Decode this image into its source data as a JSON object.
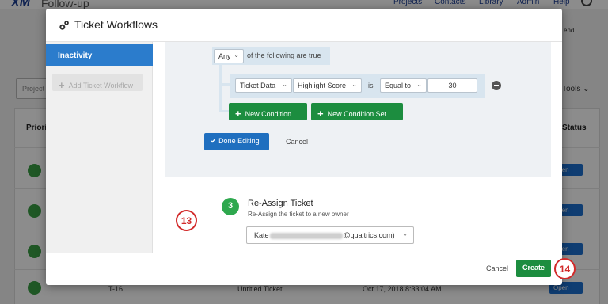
{
  "background": {
    "app_name": "Follow-up",
    "nav": [
      "Projects",
      "Contacts",
      "Library",
      "Admin",
      "Help"
    ],
    "right_snippet": "end",
    "projects_placeholder": "Project",
    "tools_label": "Tools",
    "priority_header": "Priority",
    "status_header": "Status",
    "open_label": "Open",
    "row_id": "T-16",
    "row_title": "Untitled Ticket",
    "row_date": "Oct 17, 2018 8:33:04 AM"
  },
  "modal": {
    "title": "Ticket Workflows",
    "sidebar": {
      "active_item": "Inactivity",
      "add_button": "Add Ticket Workflow"
    },
    "conditions": {
      "match_value": "Any",
      "match_text": "of the following are true",
      "field_type": "Ticket Data",
      "field_name": "Highlight Score",
      "operator_word": "is",
      "operator": "Equal to",
      "value": "30",
      "new_condition": "New Condition",
      "new_condition_set": "New Condition Set",
      "done_editing": "Done Editing",
      "cancel": "Cancel"
    },
    "step": {
      "number": "3",
      "title": "Re-Assign Ticket",
      "subtitle": "Re-Assign the ticket to a new owner",
      "owner_prefix": "Kate",
      "owner_suffix": "@qualtrics.com)"
    },
    "footer": {
      "cancel": "Cancel",
      "create": "Create"
    }
  },
  "callouts": [
    "13",
    "14"
  ],
  "colors": {
    "primary_blue": "#2b7ccc",
    "green": "#1c8d3f",
    "callout_red": "#d22a2a"
  }
}
